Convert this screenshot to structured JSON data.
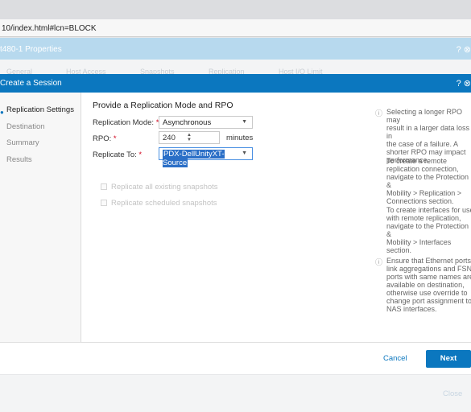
{
  "browser": {
    "url": "10/index.html#lcn=BLOCK"
  },
  "properties": {
    "title": "t480-1 Properties",
    "icons": "? ⊗",
    "tabs": [
      "General",
      "Host Access",
      "Snapshots",
      "Replication",
      "Host I/O Limit"
    ],
    "close_label": "Close"
  },
  "modal": {
    "title": "Create a Session",
    "icons": "? ⊗",
    "nav": {
      "active_marker": "●",
      "items": [
        "Replication Settings",
        "Destination",
        "Summary",
        "Results"
      ]
    },
    "heading": "Provide a Replication Mode and RPO",
    "mode": {
      "label": "Replication Mode:",
      "value": "Asynchronous"
    },
    "rpo": {
      "label": "RPO:",
      "value": "240",
      "unit": "minutes"
    },
    "replicate_to": {
      "label": "Replicate To:",
      "value": "PDX-DellUnityXT-Source"
    },
    "required_marker": "*",
    "checkboxes": [
      "Replicate all existing snapshots",
      "Replicate scheduled snapshots"
    ],
    "help": {
      "info_icon": "ⓘ",
      "block1": [
        "Selecting a longer RPO may",
        "result in a larger data loss in",
        "the case of a failure. A",
        "shorter RPO may impact",
        "performance."
      ],
      "block2": [
        "To create a remote",
        "replication connection,",
        "navigate to the Protection &",
        "Mobility > Replication >",
        "Connections section."
      ],
      "block3": [
        "To create interfaces for use",
        "with remote replication,",
        "navigate to the Protection &",
        "Mobility > Interfaces section."
      ],
      "block4": [
        "Ensure that Ethernet ports,",
        "link aggregations and FSN",
        "ports with same names are",
        "available on destination,",
        "otherwise use override to",
        "change port assignment to",
        "NAS interfaces."
      ]
    },
    "buttons": {
      "cancel": "Cancel",
      "next": "Next"
    }
  }
}
